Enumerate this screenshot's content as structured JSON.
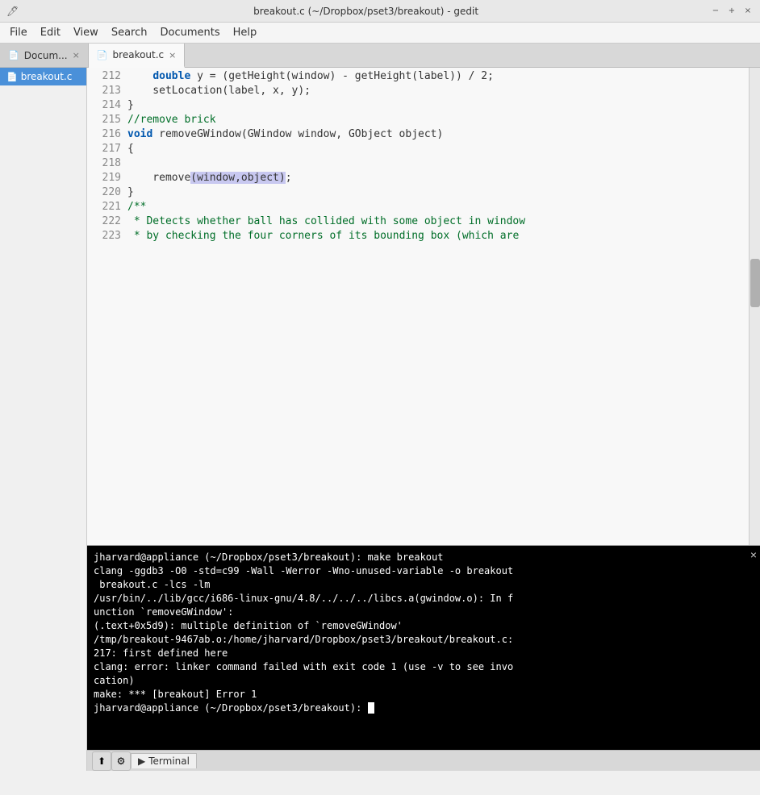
{
  "titleBar": {
    "title": "breakout.c (~/Dropbox/pset3/breakout) - gedit",
    "minBtn": "−",
    "maxBtn": "+",
    "closeBtn": "×"
  },
  "menuBar": {
    "items": [
      "File",
      "Edit",
      "View",
      "Search",
      "Documents",
      "Help"
    ]
  },
  "tabs": [
    {
      "id": "docum",
      "label": "Docum...",
      "icon": "📄",
      "active": false,
      "closable": true
    },
    {
      "id": "breakout-c",
      "label": "breakout.c",
      "icon": "📄",
      "active": true,
      "closable": true
    }
  ],
  "sideFiles": [
    {
      "id": "breakout-c-side",
      "label": "breakout.c",
      "active": true
    }
  ],
  "codeLines": [
    {
      "num": "212",
      "content": "    double y = (getHeight(window) - getHeight(label)) / 2;"
    },
    {
      "num": "213",
      "content": "    setLocation(label, x, y);"
    },
    {
      "num": "214",
      "content": "}"
    },
    {
      "num": "215",
      "content": "//remove brick"
    },
    {
      "num": "216",
      "content": "void removeGWindow(GWindow window, GObject object)"
    },
    {
      "num": "217",
      "content": "{"
    },
    {
      "num": "218",
      "content": ""
    },
    {
      "num": "219",
      "content": "    remove(window,object);"
    },
    {
      "num": "220",
      "content": "}"
    },
    {
      "num": "221",
      "content": "/**"
    },
    {
      "num": "222",
      "content": " * Detects whether ball has collided with some object in window"
    },
    {
      "num": "223",
      "content": " * by checking the four corners of its bounding box (which are"
    }
  ],
  "terminal": {
    "lines": [
      "jharvard@appliance (~/Dropbox/pset3/breakout): make breakout",
      "clang -ggdb3 -O0 -std=c99 -Wall -Werror -Wno-unused-variable -o breakout",
      " breakout.c -lcs -lm",
      "/usr/bin/../lib/gcc/i686-linux-gnu/4.8/../../../libcs.a(gwindow.o): In f",
      "unction `removeGWindow':",
      "(.text+0x5d9): multiple definition of `removeGWindow'",
      "/tmp/breakout-9467ab.o:/home/jharvard/Dropbox/pset3/breakout/breakout.c:",
      "217: first defined here",
      "clang: error: linker command failed with exit code 1 (use -v to see invo",
      "cation)",
      "make: *** [breakout] Error 1",
      "jharvard@appliance (~/Dropbox/pset3/breakout): "
    ]
  },
  "terminalTab": {
    "label": "Terminal",
    "icon": "▶"
  },
  "bottomBar": {
    "btn1": "⬆",
    "btn2": "⚙"
  }
}
